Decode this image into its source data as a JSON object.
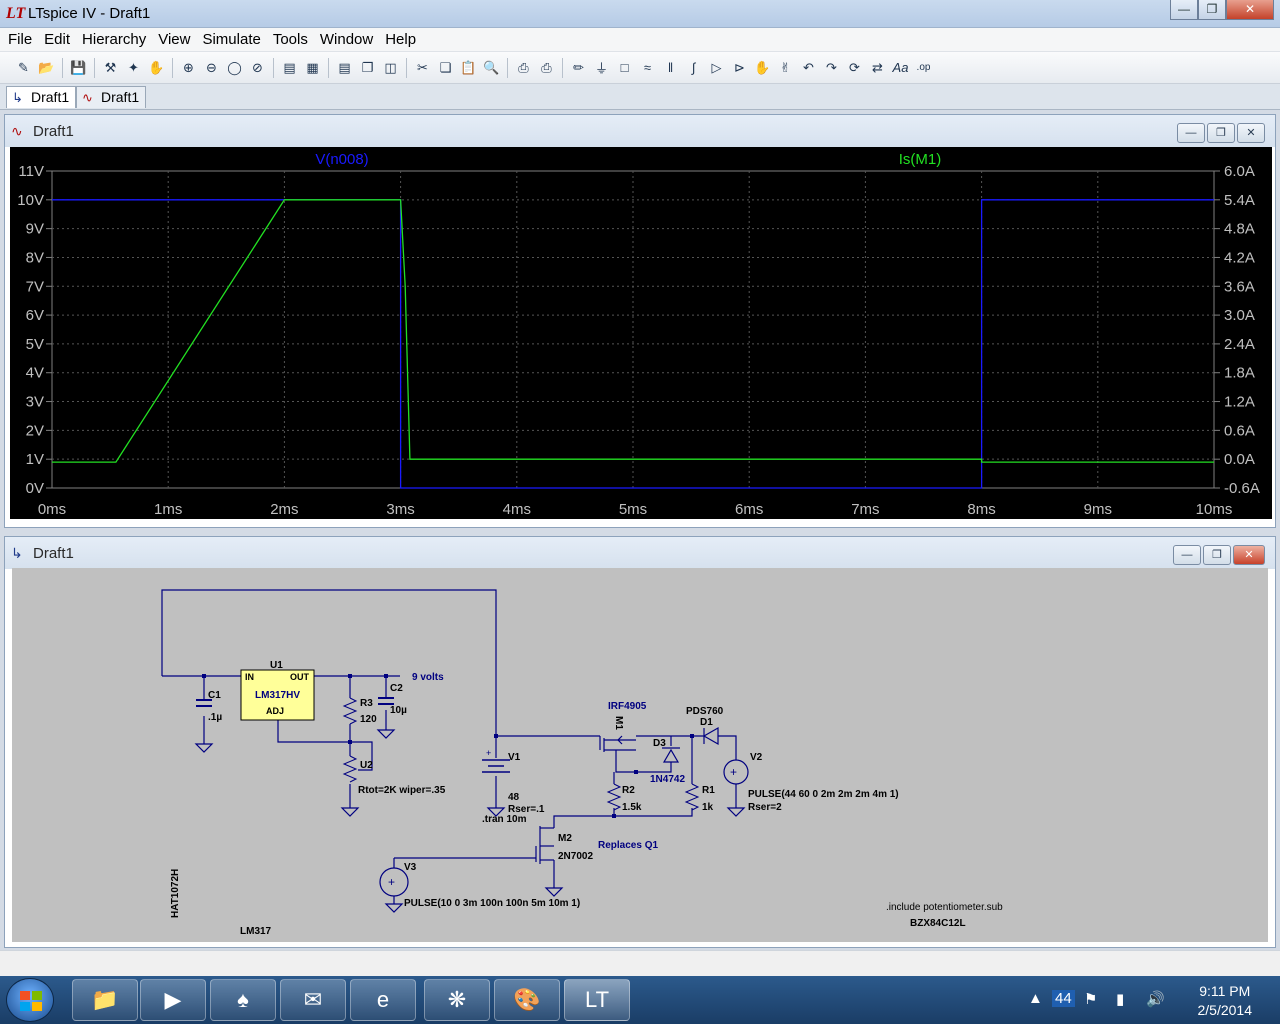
{
  "window": {
    "title": "LTspice IV - Draft1"
  },
  "menu": [
    "File",
    "Edit",
    "Hierarchy",
    "View",
    "Simulate",
    "Tools",
    "Window",
    "Help"
  ],
  "toolbar": {
    "icons": [
      "new-schematic-icon",
      "open-icon",
      "save-icon",
      "control-panel-icon",
      "run-icon",
      "halt-icon",
      "zoom-in-icon",
      "zoom-out-icon",
      "zoom-fit-icon",
      "zoom-cancel-icon",
      "autorange-icon",
      "grid-icon",
      "tile-horizontal-icon",
      "cascade-icon",
      "tile-vertical-icon",
      "cut-icon",
      "copy-icon",
      "paste-icon",
      "find-icon",
      "print-setup-icon",
      "print-icon",
      "wire-icon",
      "ground-icon",
      "label-icon",
      "resistor-icon",
      "capacitor-icon",
      "inductor-icon",
      "diode-icon",
      "component-icon",
      "move-icon",
      "drag-icon",
      "undo-icon",
      "redo-icon",
      "rotate-icon",
      "mirror-icon",
      "text-icon",
      "spice-directive-icon"
    ]
  },
  "tabs": [
    {
      "label": "Draft1",
      "type": "schematic"
    },
    {
      "label": "Draft1",
      "type": "waveform"
    }
  ],
  "plot_window": {
    "title": "Draft1"
  },
  "schematic_window": {
    "title": "Draft1"
  },
  "chart_data": {
    "type": "line",
    "background": "#000000",
    "x_ticks": [
      "0ms",
      "1ms",
      "2ms",
      "3ms",
      "4ms",
      "5ms",
      "6ms",
      "7ms",
      "8ms",
      "9ms",
      "10ms"
    ],
    "xlim": [
      0,
      10
    ],
    "y_left_ticks": [
      "0V",
      "1V",
      "2V",
      "3V",
      "4V",
      "5V",
      "6V",
      "7V",
      "8V",
      "9V",
      "10V",
      "11V"
    ],
    "ylim_left": [
      0,
      11
    ],
    "y_right_ticks": [
      "-0.6A",
      "0.0A",
      "0.6A",
      "1.2A",
      "1.8A",
      "2.4A",
      "3.0A",
      "3.6A",
      "4.2A",
      "4.8A",
      "5.4A",
      "6.0A"
    ],
    "ylim_right": [
      -0.6,
      6.0
    ],
    "series": [
      {
        "name": "V(n008)",
        "color": "#1a1aff",
        "axis": "left",
        "x": [
          0,
          3.0,
          3.0,
          8.0,
          8.0,
          10.0
        ],
        "y": [
          10,
          10,
          0,
          0,
          10,
          10
        ]
      },
      {
        "name": "Is(M1)",
        "color": "#22e022",
        "axis": "right",
        "x": [
          0,
          0.55,
          2.0,
          3.0,
          3.04,
          3.08,
          8.0,
          8.0,
          10.0
        ],
        "y": [
          -0.06,
          -0.06,
          5.4,
          5.4,
          3.6,
          0.0,
          0.0,
          -0.06,
          -0.06
        ]
      }
    ]
  },
  "schematic": {
    "labels": {
      "u1_ref": "U1",
      "u1_value": "LM317HV",
      "u1_in": "IN",
      "u1_out": "OUT",
      "u1_adj": "ADJ",
      "c1_ref": "C1",
      "c1_value": ".1µ",
      "c2_ref": "C2",
      "c2_value": "10µ",
      "r3_ref": "R3",
      "r3_value": "120",
      "u2_ref": "U2",
      "u2_value": "Rtot=2K wiper=.35",
      "net_9v": "9 volts",
      "v1_ref": "V1",
      "v1_value": "48",
      "v1_rser": "Rser=.1",
      "tran": ".tran 10m",
      "m1_ref": "M1",
      "m1_value": "IRF4905",
      "d3_ref": "D3",
      "d3_value": "1N4742",
      "d1_ref": "D1",
      "d1_value": "PDS760",
      "v2_ref": "V2",
      "v2_value": "PULSE(44 60 0 2m 2m 2m 4m 1)",
      "v2_rser": "Rser=2",
      "r2_ref": "R2",
      "r2_value": "1.5k",
      "r1_ref": "R1",
      "r1_value": "1k",
      "m2_ref": "M2",
      "m2_value": "2N7002",
      "replaces": "Replaces Q1",
      "v3_ref": "V3",
      "v3_value": "PULSE(10 0 3m 100n 100n 5m 10m 1)",
      "hat": "HAT1072H",
      "lm317": "LM317",
      "include": ".include potentiometer.sub",
      "bzx": "BZX84C12L"
    }
  },
  "taskbar": {
    "apps": [
      "windows-explorer-icon",
      "media-player-icon",
      "solitaire-icon",
      "outlook-icon",
      "internet-explorer-icon",
      "acrobat-icon",
      "paint-icon",
      "ltspice-icon"
    ],
    "tray_count": "44",
    "time": "9:11 PM",
    "date": "2/5/2014"
  }
}
